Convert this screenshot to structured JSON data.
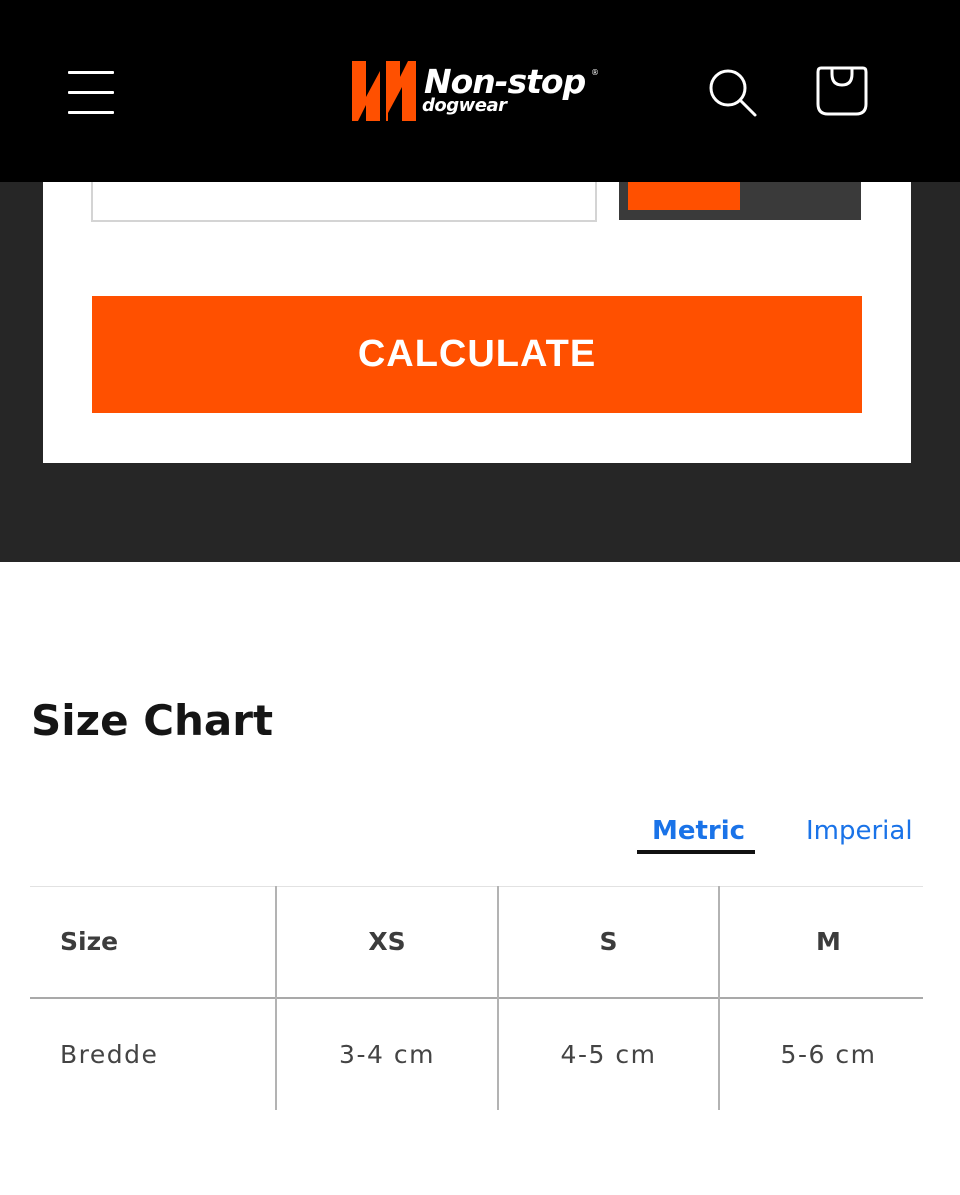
{
  "header": {
    "logo": {
      "word1": "Non-stop",
      "word2": "dogwear",
      "reg": "®"
    },
    "colors": {
      "background": "#000000",
      "brand_orange": "#ff5000"
    },
    "icons": {
      "menu": "hamburger-menu-icon",
      "search": "search-icon",
      "cart": "shopping-bag-icon"
    }
  },
  "calculator": {
    "button_label": "CALCULATE",
    "colors": {
      "accent": "#ff5000",
      "toggle_bg": "#3a3a3a",
      "band_bg": "#262626"
    }
  },
  "size_chart": {
    "title": "Size Chart",
    "tabs": [
      {
        "label": "Metric",
        "active": true
      },
      {
        "label": "Imperial",
        "active": false
      }
    ],
    "columns": [
      "Size",
      "XS",
      "S",
      "M"
    ],
    "rows": [
      {
        "label": "Bredde",
        "values": [
          "3-4 cm",
          "4-5 cm",
          "5-6 cm"
        ]
      }
    ],
    "colors": {
      "tab_link": "#1a73e8"
    }
  }
}
